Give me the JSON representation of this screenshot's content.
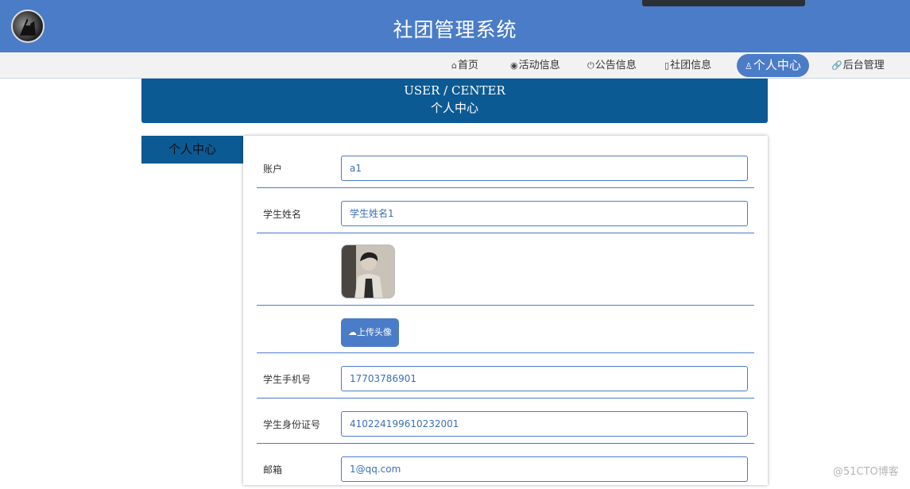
{
  "header": {
    "title": "社团管理系统"
  },
  "nav": {
    "items": [
      {
        "icon": "home-icon",
        "glyph": "⌂",
        "label": "首页"
      },
      {
        "icon": "activity-icon",
        "glyph": "◉",
        "label": "活动信息"
      },
      {
        "icon": "power-icon",
        "glyph": "⏻",
        "label": "公告信息"
      },
      {
        "icon": "note-icon",
        "glyph": "▯",
        "label": "社团信息"
      },
      {
        "icon": "user-icon",
        "glyph": "♙",
        "label": "个人中心",
        "active": true
      },
      {
        "icon": "link-icon",
        "glyph": "🔗",
        "label": "后台管理"
      }
    ]
  },
  "banner": {
    "en": "USER / CENTER",
    "cn": "个人中心"
  },
  "sidebar": {
    "items": [
      {
        "label": "个人中心"
      }
    ]
  },
  "form": {
    "account_label": "账户",
    "account_value": "a1",
    "name_label": "学生姓名",
    "name_value": "学生姓名1",
    "upload_label": "上传头像",
    "phone_label": "学生手机号",
    "phone_value": "17703786901",
    "idcard_label": "学生身份证号",
    "idcard_value": "410224199610232001",
    "email_label": "邮箱",
    "email_value": "1@qq.com"
  },
  "watermark": "@51CTO博客",
  "colors": {
    "primary": "#4a7cc8",
    "banner": "#0c5a94"
  }
}
